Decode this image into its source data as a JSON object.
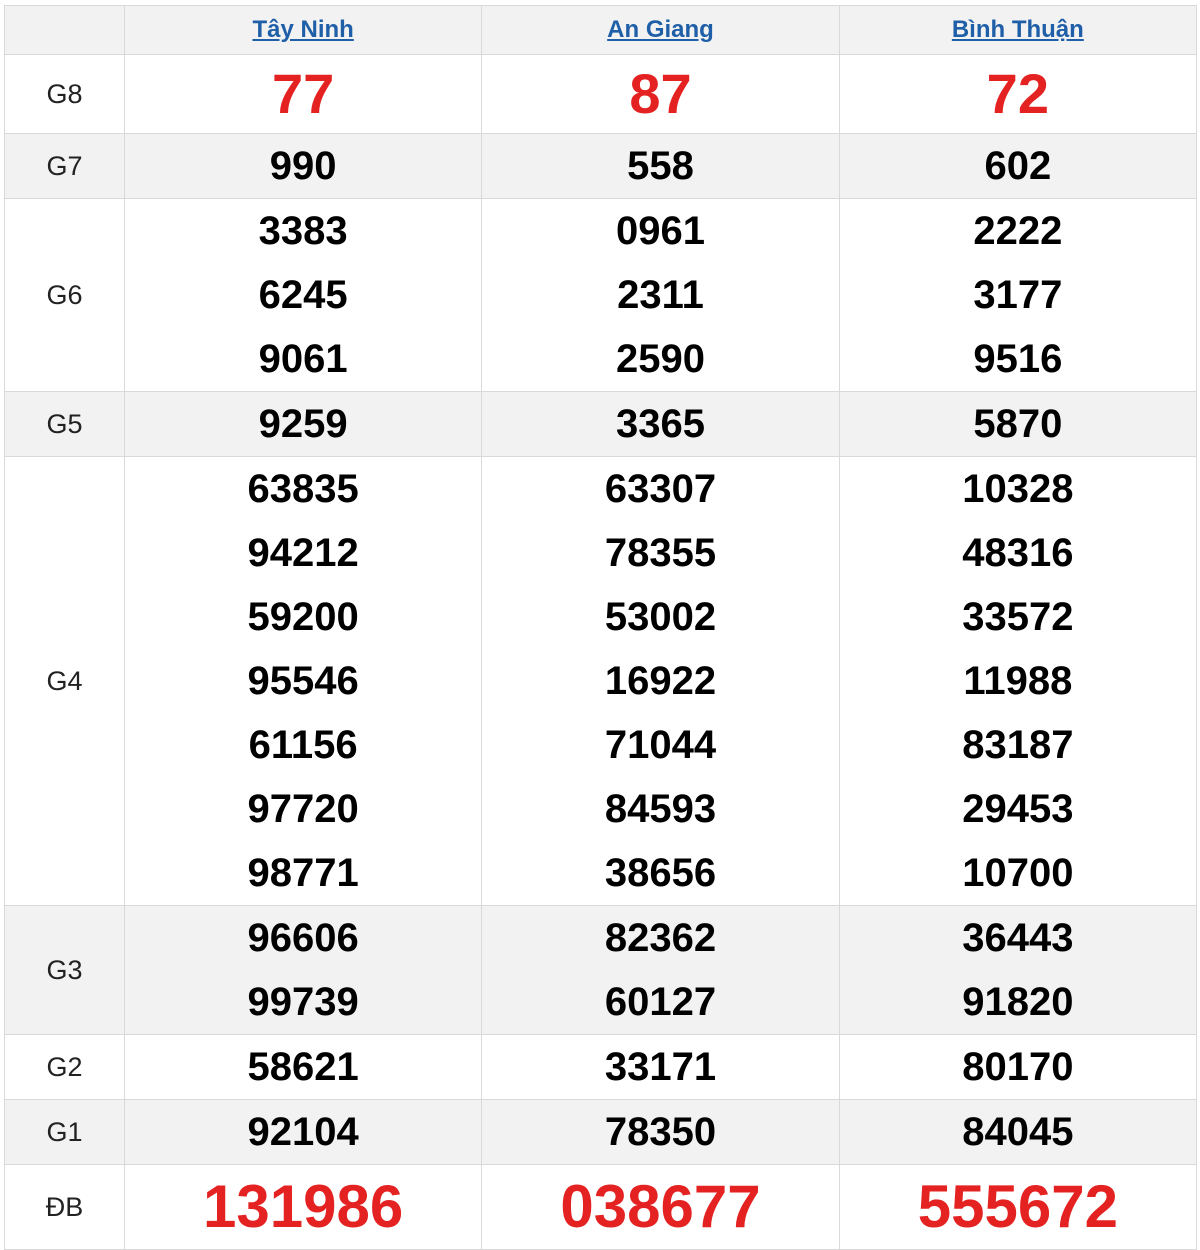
{
  "provinces": [
    "Tây Ninh",
    "An Giang",
    "Bình Thuận"
  ],
  "prizes": {
    "g8": {
      "label": "G8",
      "values": [
        "77",
        "87",
        "72"
      ]
    },
    "g7": {
      "label": "G7",
      "values": [
        "990",
        "558",
        "602"
      ]
    },
    "g6": {
      "label": "G6",
      "values": [
        [
          "3383",
          "6245",
          "9061"
        ],
        [
          "0961",
          "2311",
          "2590"
        ],
        [
          "2222",
          "3177",
          "9516"
        ]
      ]
    },
    "g5": {
      "label": "G5",
      "values": [
        "9259",
        "3365",
        "5870"
      ]
    },
    "g4": {
      "label": "G4",
      "values": [
        [
          "63835",
          "94212",
          "59200",
          "95546",
          "61156",
          "97720",
          "98771"
        ],
        [
          "63307",
          "78355",
          "53002",
          "16922",
          "71044",
          "84593",
          "38656"
        ],
        [
          "10328",
          "48316",
          "33572",
          "11988",
          "83187",
          "29453",
          "10700"
        ]
      ]
    },
    "g3": {
      "label": "G3",
      "values": [
        [
          "96606",
          "99739"
        ],
        [
          "82362",
          "60127"
        ],
        [
          "36443",
          "91820"
        ]
      ]
    },
    "g2": {
      "label": "G2",
      "values": [
        "58621",
        "33171",
        "80170"
      ]
    },
    "g1": {
      "label": "G1",
      "values": [
        "92104",
        "78350",
        "84045"
      ]
    },
    "db": {
      "label": "ĐB",
      "values": [
        "131986",
        "038677",
        "555672"
      ]
    }
  },
  "colors": {
    "red": "#e52222",
    "link": "#1f5fa8",
    "shade": "#f2f2f2",
    "border": "#d9d9d9"
  }
}
